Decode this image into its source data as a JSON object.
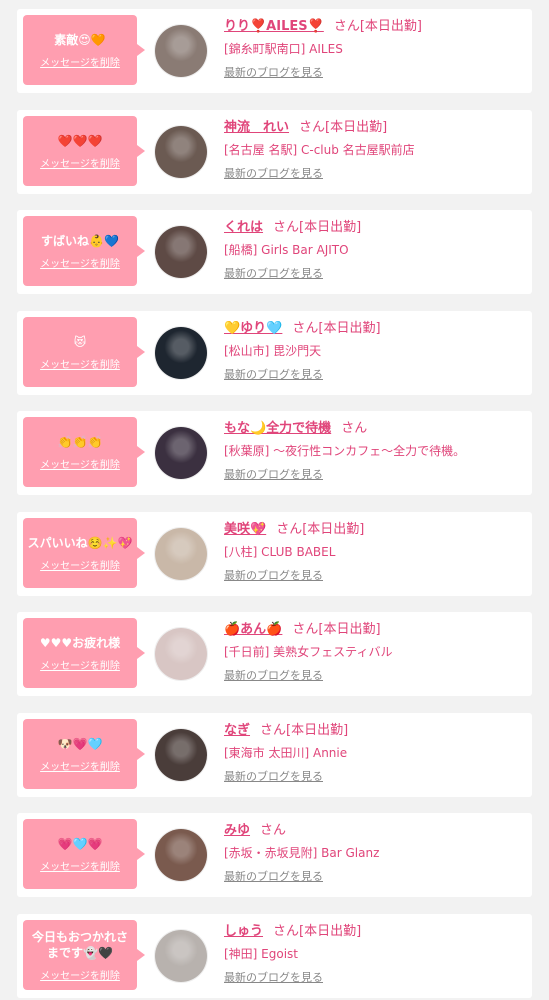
{
  "delete_label": "メッセージを削除",
  "blog_label": "最新のブログを見る",
  "accent_color": "#ff9eb0",
  "name_color": "#e0457a",
  "cards": [
    {
      "message": "素敵😍🧡",
      "name": "りり❣️AILES❣️",
      "san": "さん",
      "status": "[本日出勤]",
      "shop": "[錦糸町駅南口] AILES",
      "avatar_bg": "#8a7b74"
    },
    {
      "message": "❤️❤️❤️",
      "name": "神流　れい",
      "san": "さん",
      "status": "[本日出勤]",
      "shop": "[名古屋 名駅] C-club 名古屋駅前店",
      "avatar_bg": "#6b5a52"
    },
    {
      "message": "すばいね👶💙",
      "name": "くれは",
      "san": "さん",
      "status": "[本日出勤]",
      "shop": "[船橋] Girls Bar AJITO",
      "avatar_bg": "#5e4a45"
    },
    {
      "message": "😻",
      "name": "💛ゆり🩵",
      "san": "さん",
      "status": "[本日出勤]",
      "shop": "[松山市] 毘沙門天",
      "avatar_bg": "#1e2630"
    },
    {
      "message": "👏👏👏",
      "name": "もな🌙全力で待機",
      "san": "さん",
      "status": "",
      "shop": "[秋葉原] 〜夜行性コンカフェ〜全力で待機。",
      "avatar_bg": "#3b3040"
    },
    {
      "message": "スパいいね☺️✨💖",
      "name": "美咲💖",
      "san": "さん",
      "status": "[本日出勤]",
      "shop": "[八柱] CLUB BABEL",
      "avatar_bg": "#c9b8a8"
    },
    {
      "message": "♥♥♥お疲れ様",
      "name": "🍎あん🍎",
      "san": "さん",
      "status": "[本日出勤]",
      "shop": "[千日前] 美熟女フェスティバル",
      "avatar_bg": "#d8c6c4"
    },
    {
      "message": "🐶💗🩵",
      "name": "なぎ",
      "san": "さん",
      "status": "[本日出勤]",
      "shop": "[東海市 太田川] Annie",
      "avatar_bg": "#4a3d3a"
    },
    {
      "message": "💗🩵💗",
      "name": "みゆ",
      "san": "さん",
      "status": "",
      "shop": "[赤坂・赤坂見附] Bar Glanz",
      "avatar_bg": "#7a5a4e"
    },
    {
      "message": "今日もおつかれさまです👻🖤",
      "name": "しゅう",
      "san": "さん",
      "status": "[本日出勤]",
      "shop": "[神田] Egoist",
      "avatar_bg": "#b8b2ae"
    }
  ]
}
